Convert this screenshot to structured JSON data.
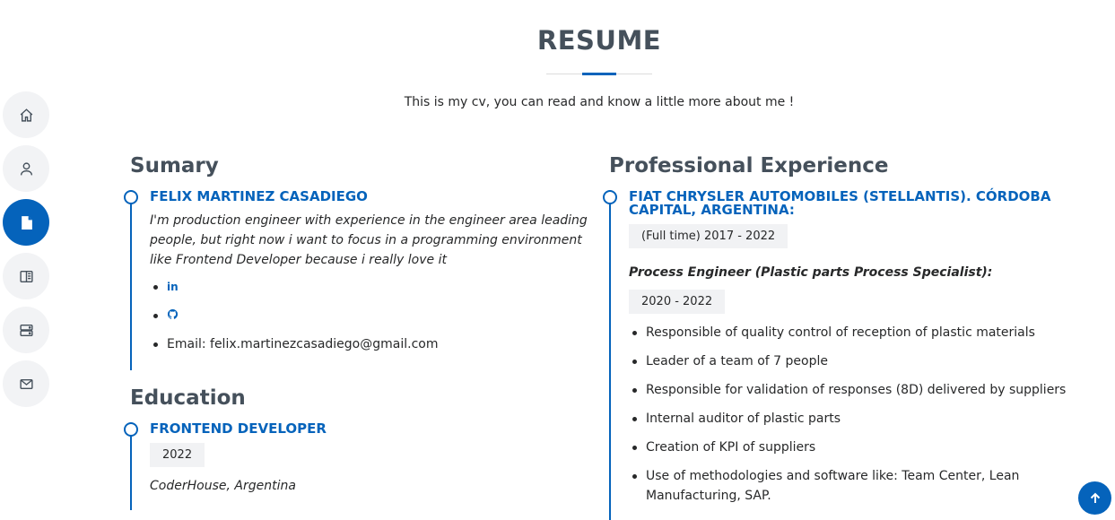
{
  "nav": {
    "items": [
      {
        "icon": "home-icon",
        "name": "home"
      },
      {
        "icon": "person-icon",
        "name": "about"
      },
      {
        "icon": "file-icon",
        "name": "resume"
      },
      {
        "icon": "book-icon",
        "name": "portfolio"
      },
      {
        "icon": "server-icon",
        "name": "services"
      },
      {
        "icon": "envelope-icon",
        "name": "contact"
      }
    ],
    "active": "resume"
  },
  "header": {
    "title": "RESUME",
    "subtitle": "This is my cv, you can read and know a little more about me !"
  },
  "summary": {
    "section_title": "Sumary",
    "name": "FELIX MARTINEZ CASADIEGO",
    "description": "I'm production engineer with experience in the engineer area leading people, but right now i want to focus in a programming environment like Frontend Developer because i really love it",
    "linkedin_icon": "in",
    "github_icon": "github-icon",
    "email": "Email: felix.martinezcasadiego@gmail.com"
  },
  "education": {
    "section_title": "Education",
    "degree": "FRONTEND DEVELOPER",
    "year": "2022",
    "school": "CoderHouse, Argentina"
  },
  "experience": {
    "section_title": "Professional Experience",
    "company": "FIAT CHRYSLER AUTOMOBILES (STELLANTIS). CÓRDOBA CAPITAL, ARGENTINA:",
    "period": "(Full time) 2017 - 2022",
    "role": "Process Engineer (Plastic parts Process Specialist):",
    "role_period": "2020 - 2022",
    "bullets": [
      "Responsible of quality control of reception of plastic materials",
      "Leader of a team of 7 people",
      "Responsible for validation of responses (8D) delivered by suppliers",
      "Internal auditor of plastic parts",
      "Creation of KPI of suppliers",
      "Use of methodologies and software like: Team Center, Lean Manufacturing, SAP."
    ]
  },
  "colors": {
    "accent": "#0563bb",
    "heading": "#45505b",
    "text": "#272829",
    "nav_bg": "#f2f3f5"
  }
}
